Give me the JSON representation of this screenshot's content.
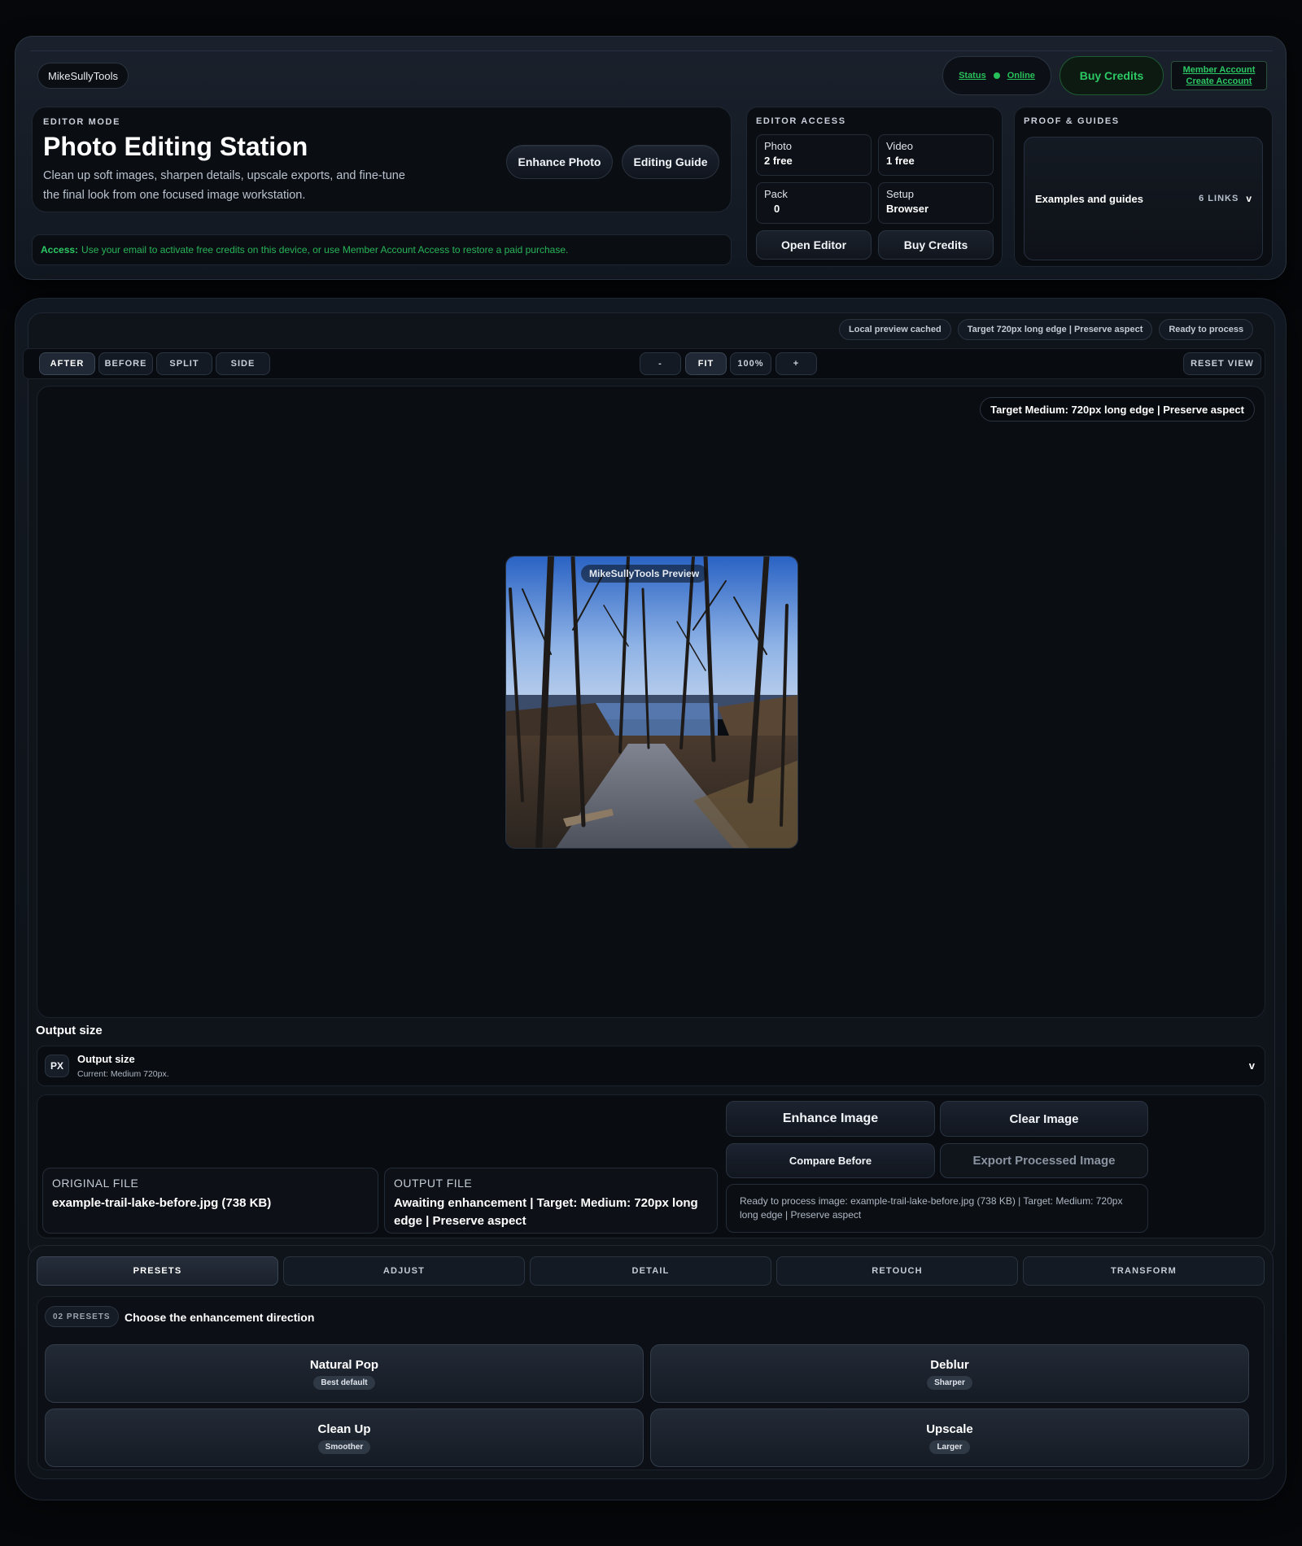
{
  "header": {
    "brand": "MikeSullyTools",
    "status_label": "Status",
    "status_value": "Online",
    "buy_credits": "Buy Credits",
    "member_account": "Member Account",
    "create_account": "Create Account"
  },
  "editor_mode": {
    "eyebrow": "EDITOR MODE",
    "title": "Photo Editing Station",
    "description": "Clean up soft images, sharpen details, upscale exports, and fine-tune the final look from one focused image workstation.",
    "enhance_photo": "Enhance Photo",
    "editing_guide": "Editing Guide"
  },
  "access": {
    "label": "Access:",
    "text": "Use your email to activate free credits on this device, or use Member Account Access to restore a paid purchase."
  },
  "editor_access": {
    "eyebrow": "EDITOR ACCESS",
    "stats": [
      {
        "key": "Photo",
        "value": "2 free"
      },
      {
        "key": "Video",
        "value": "1 free"
      },
      {
        "key": "Pack",
        "value": "0"
      },
      {
        "key": "Setup",
        "value": "Browser"
      }
    ],
    "open_editor": "Open Editor",
    "buy_credits": "Buy Credits"
  },
  "proof": {
    "eyebrow": "PROOF & GUIDES",
    "examples": "Examples and guides",
    "links": "6 LINKS",
    "chevron": "v"
  },
  "chips": [
    "Local preview cached",
    "Target 720px long edge | Preserve aspect",
    "Ready to process"
  ],
  "toolbar": {
    "modes": [
      "AFTER",
      "BEFORE",
      "SPLIT",
      "SIDE"
    ],
    "zoom": [
      "-",
      "FIT",
      "100%",
      "+"
    ],
    "reset": "RESET VIEW"
  },
  "viewer": {
    "target_badge": "Target Medium: 720px long edge | Preserve aspect",
    "preview_label": "MikeSullyTools Preview"
  },
  "output_size": {
    "section_title": "Output size",
    "badge": "PX",
    "title": "Output size",
    "current": "Current: Medium 720px.",
    "chevron": "v"
  },
  "actions": {
    "enhance_image": "Enhance Image",
    "clear_image": "Clear Image",
    "compare_before": "Compare Before",
    "export": "Export Processed Image",
    "status": "Ready to process image: example-trail-lake-before.jpg (738 KB) | Target: Medium: 720px long edge | Preserve aspect"
  },
  "files": {
    "original_label": "ORIGINAL FILE",
    "original_value": "example-trail-lake-before.jpg (738 KB)",
    "output_label": "OUTPUT FILE",
    "output_value": "Awaiting enhancement | Target: Medium: 720px long edge | Preserve aspect"
  },
  "tabs": [
    "PRESETS",
    "ADJUST",
    "DETAIL",
    "RETOUCH",
    "TRANSFORM"
  ],
  "presets": {
    "count": "02 PRESETS",
    "heading": "Choose the enhancement direction",
    "items": [
      {
        "name": "Natural Pop",
        "tag": "Best default"
      },
      {
        "name": "Deblur",
        "tag": "Sharper"
      },
      {
        "name": "Clean Up",
        "tag": "Smoother"
      },
      {
        "name": "Upscale",
        "tag": "Larger"
      }
    ]
  },
  "colors": {
    "accent_green": "#2cc864",
    "background": "#05070a"
  }
}
